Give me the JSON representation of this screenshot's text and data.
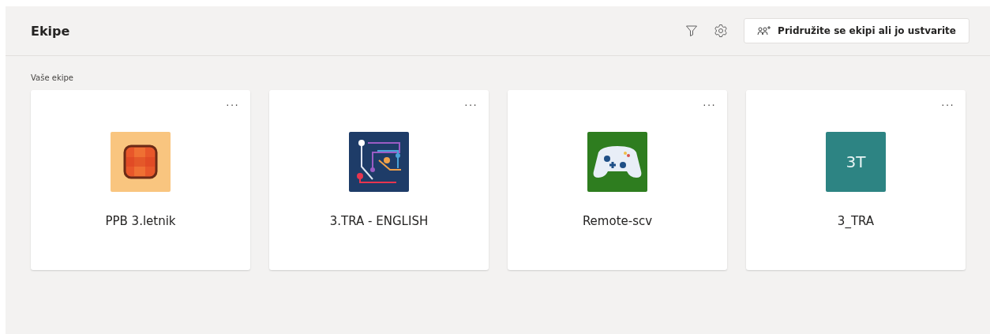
{
  "header": {
    "title": "Ekipe",
    "join_button": "Pridružite se ekipi ali jo ustvarite"
  },
  "section_label": "Vaše ekipe",
  "teams": [
    {
      "name": "PPB 3.letnik",
      "more": "···",
      "icon": {
        "kind": "tiles"
      }
    },
    {
      "name": "3.TRA - ENGLISH",
      "more": "···",
      "icon": {
        "kind": "circuit"
      }
    },
    {
      "name": "Remote-scv",
      "more": "···",
      "icon": {
        "kind": "gamepad"
      }
    },
    {
      "name": "3_TRA",
      "more": "···",
      "icon": {
        "kind": "initials",
        "text": "3T"
      }
    }
  ]
}
